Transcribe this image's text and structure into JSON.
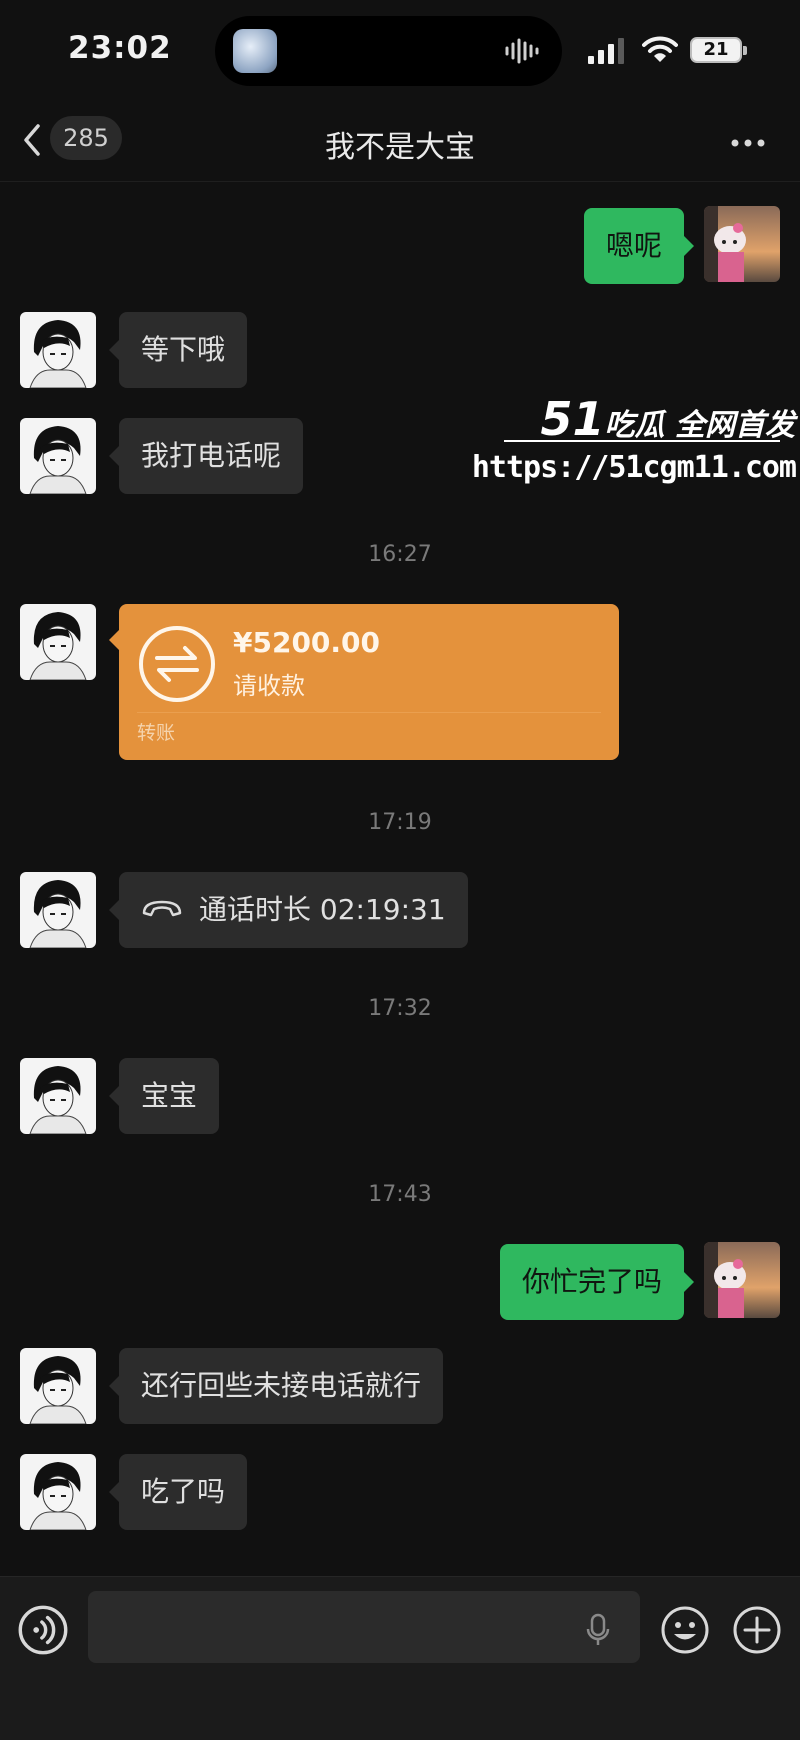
{
  "status_bar": {
    "time": "23:02",
    "battery": "21"
  },
  "nav": {
    "unread_count": "285",
    "title": "我不是大宝"
  },
  "messages": {
    "m1": "嗯呢",
    "m2": "等下哦",
    "m3": "我打电话呢",
    "t1": "16:27",
    "transfer": {
      "amount": "¥5200.00",
      "note": "请收款",
      "label": "转账"
    },
    "t2": "17:19",
    "call": "通话时长 02:19:31",
    "t3": "17:32",
    "m4": "宝宝",
    "t4": "17:43",
    "m5": "你忙完了吗",
    "m6": "还行回些未接电话就行",
    "m7": "吃了吗"
  },
  "watermark": {
    "brand_num": "51",
    "brand_text": "吃瓜 全网首发",
    "url": "https://51cgm11.com"
  },
  "input": {
    "value": ""
  },
  "colors": {
    "background": "#111111",
    "bubble_incoming": "#2c2c2c",
    "bubble_outgoing": "#2fb85f",
    "transfer": "#e4923c"
  }
}
